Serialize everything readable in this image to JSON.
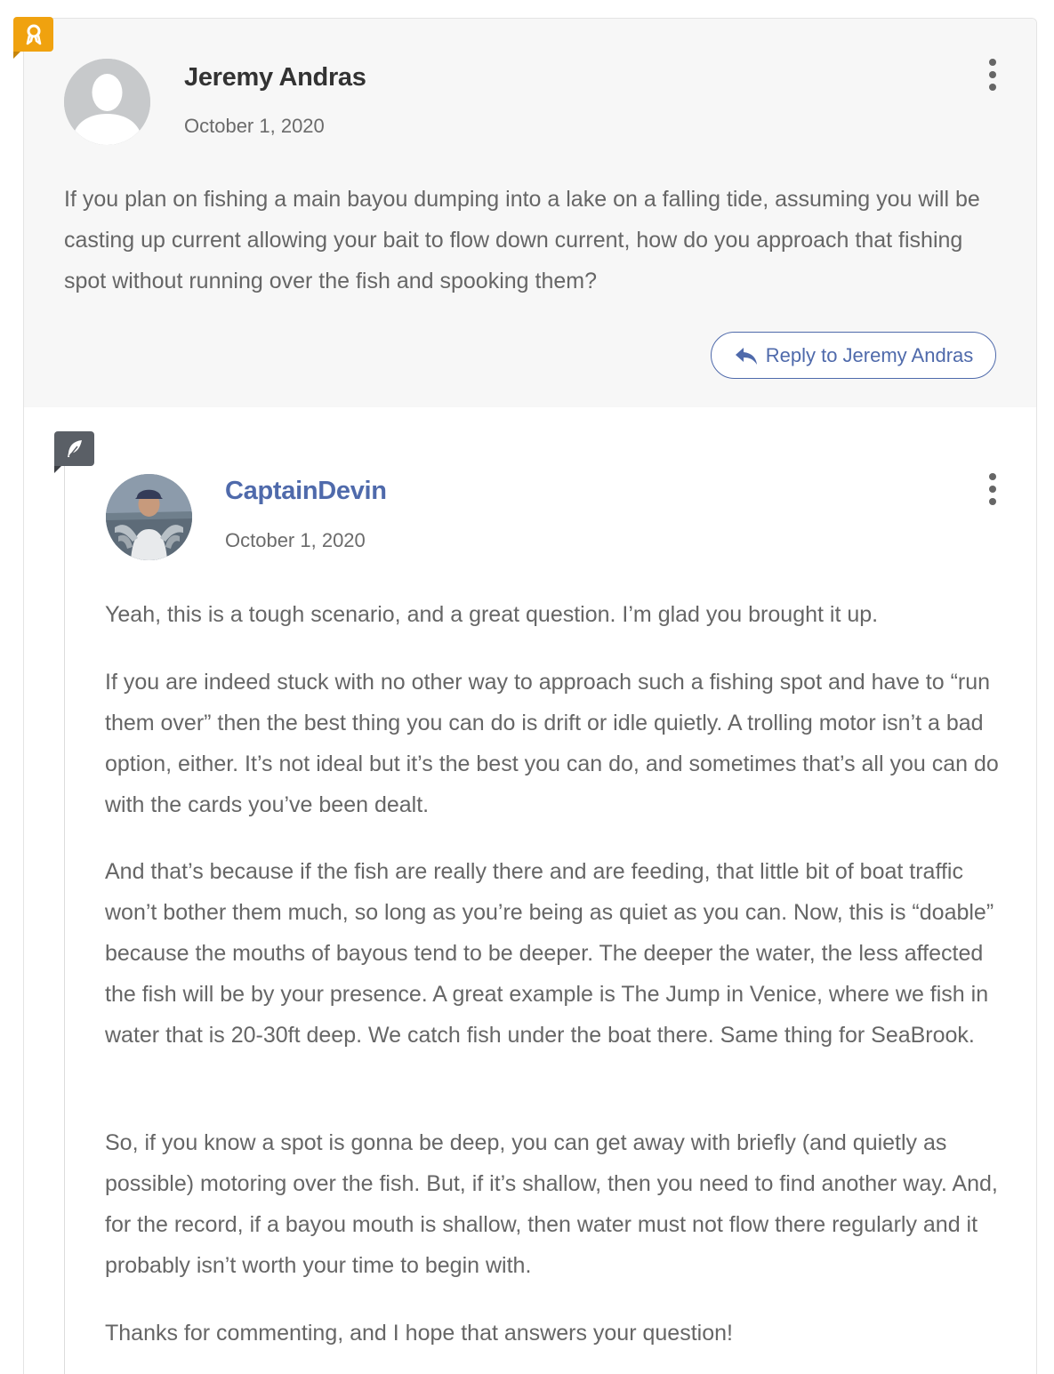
{
  "parent_comment": {
    "author": "Jeremy Andras",
    "date": "October 1, 2020",
    "text": "If you plan on fishing a main bayou dumping into a lake on a falling tide, assuming you will be casting up current allowing your bait to flow down current, how do you approach that fishing spot without running over the fish and spooking them?",
    "reply_button_label": "Reply to Jeremy Andras",
    "badge_icon": "award-icon",
    "badge_color": "#f0a20f"
  },
  "reply_comment": {
    "author": "CaptainDevin",
    "author_color": "#4f6aab",
    "date": "October 1, 2020",
    "badge_icon": "feather-icon",
    "badge_color": "#5a5f66",
    "paragraphs": [
      "Yeah, this is a tough scenario, and a great question. I’m glad you brought it up.",
      "If you are indeed stuck with no other way to approach such a fishing spot and have to “run them over” then the best thing you can do is drift or idle quietly. A trolling motor isn’t a bad option, either. It’s not ideal but it’s the best you can do, and sometimes that’s all you can do with the cards you’ve been dealt.",
      "And that’s because if the fish are really there and are feeding, that little bit of boat traffic won’t bother them much, so long as you’re being as quiet as you can. Now, this is “doable” because the mouths of bayous tend to be deeper. The deeper the water, the less affected the fish will be by your presence. A great example is The Jump in Venice, where we fish in water that is 20-30ft deep. We catch fish under the boat there. Same thing for SeaBrook.",
      "So, if you know a spot is gonna be deep, you can get away with briefly (and quietly as possible) motoring over the fish. But, if it’s shallow, then you need to find another way. And, for the record, if a bayou mouth is shallow, then water must not flow there regularly and it probably isn’t worth your time to begin with.",
      "Thanks for commenting, and I hope that answers your question!"
    ]
  }
}
